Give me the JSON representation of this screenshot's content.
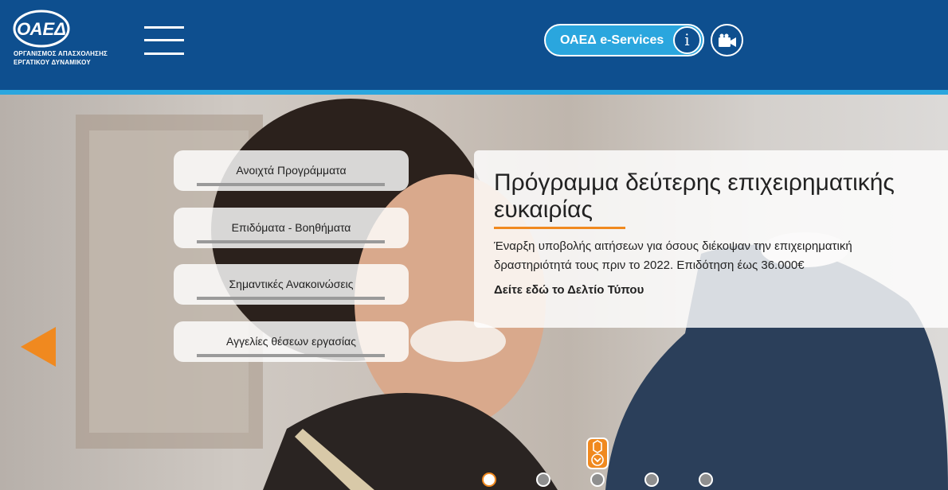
{
  "header": {
    "logo_text": "ΟΑΕΔ",
    "org_name_line1": "ΟΡΓΑΝΙΣΜΟΣ ΑΠΑΣΧΟΛΗΣΗΣ",
    "org_name_line2": "ΕΡΓΑΤΙΚΟΥ ΔΥΝΑΜΙΚΟΥ",
    "eservices_label": "ΟΑΕΔ e-Services",
    "info_label": "i"
  },
  "menu": [
    {
      "label": "Ανοιχτά Προγράμματα"
    },
    {
      "label": "Επιδόματα - Βοηθήματα"
    },
    {
      "label": "Σημαντικές Ανακοινώσεις"
    },
    {
      "label": "Αγγελίες θέσεων εργασίας"
    }
  ],
  "slide": {
    "title": "Πρόγραμμα δεύτερης επιχειρηματικής ευκαιρίας",
    "description": "Έναρξη υποβολής αιτήσεων για όσους διέκοψαν την επιχειρηματική δραστηριότητά τους πριν το 2022. Επιδότηση έως 36.000€",
    "link": "Δείτε εδώ το Δελτίο Τύπου"
  },
  "carousel": {
    "slide_count": 5,
    "active_index": 0
  },
  "colors": {
    "header_bg": "#0e4f8f",
    "accent_blue": "#2aa6de",
    "accent_orange": "#f0891f"
  },
  "icons": {
    "menu": "hamburger-icon",
    "info": "info-icon",
    "video": "video-camera-icon",
    "prev": "triangle-left-icon",
    "scroll": "chevron-down-icon"
  }
}
